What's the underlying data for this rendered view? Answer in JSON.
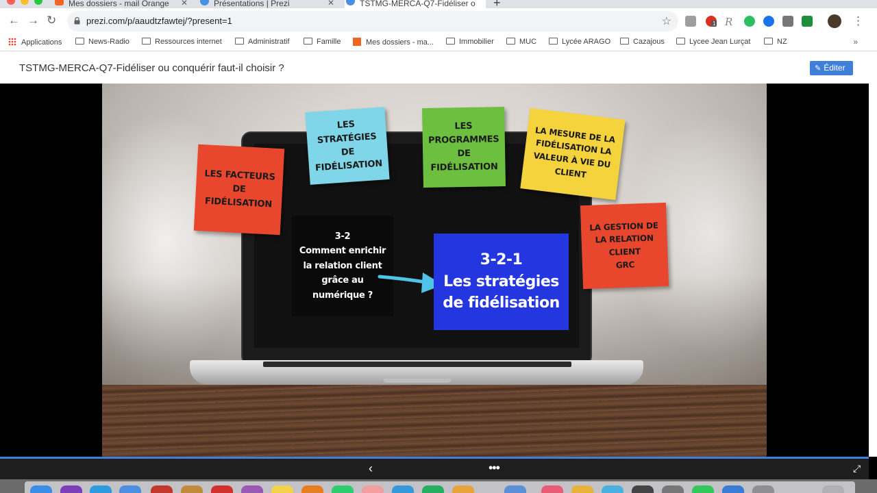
{
  "browser": {
    "tabs": [
      {
        "title": "Mes dossiers - mail Orange",
        "active": false,
        "favicon_color": "#f16522"
      },
      {
        "title": "Présentations | Prezi",
        "active": false,
        "favicon_color": "#4a90e2"
      },
      {
        "title": "TSTMG-MERCA-Q7-Fidéliser o",
        "active": true,
        "favicon_color": "#4a90e2"
      }
    ],
    "url": "prezi.com/p/aaudtzfawtej/?present=1",
    "bookmarks": [
      {
        "label": "Applications",
        "icon": "apps-grid-icon"
      },
      {
        "label": "News-Radio",
        "icon": "folder-icon"
      },
      {
        "label": "Ressources internet",
        "icon": "folder-icon"
      },
      {
        "label": "Administratif",
        "icon": "folder-icon"
      },
      {
        "label": "Famille",
        "icon": "folder-icon"
      },
      {
        "label": "Mes dossiers - ma...",
        "icon": "orange-icon"
      },
      {
        "label": "Immobilier",
        "icon": "folder-icon"
      },
      {
        "label": "MUC",
        "icon": "folder-icon"
      },
      {
        "label": "Lycée ARAGO",
        "icon": "folder-icon"
      },
      {
        "label": "Cazajous",
        "icon": "folder-icon"
      },
      {
        "label": "Lycee Jean Lurçat",
        "icon": "folder-icon"
      },
      {
        "label": "NZ",
        "icon": "folder-icon"
      }
    ],
    "extension_badge": "1"
  },
  "prezi": {
    "title": "TSTMG-MERCA-Q7-Fidéliser ou conquérir faut-il choisir ?",
    "edit_label": "Éditer"
  },
  "slide": {
    "notes": [
      {
        "id": "facteurs",
        "text": "Les facteurs\nde\nfidélisation",
        "color": "#e8472d"
      },
      {
        "id": "strategies",
        "text": "Les stratégies\nde\nfidélisation",
        "color": "#7fd6e8"
      },
      {
        "id": "programmes",
        "text": "Les\nprogrammes\nde\nfidélisation",
        "color": "#6cbf3f"
      },
      {
        "id": "mesure",
        "text": "La mesure de la\nfidélisation la\nvaleur à vie du\nclient",
        "color": "#f5d33c"
      },
      {
        "id": "grc",
        "text": "La gestion de\nla relation\nclient\nGRC",
        "color": "#e8472d"
      }
    ],
    "main_question": "3-2\nComment enrichir\nla relation client\ngrâce au\nnumérique ?",
    "current_topic": "3-2-1\nLes stratégies\nde fidélisation",
    "colors": {
      "black_box": "#0a0a0a",
      "blue_box": "#2436e0",
      "arrow": "#4fc3e8"
    }
  },
  "controls": {
    "prev_icon": "chevron-left-icon",
    "more_icon": "more-dots-icon",
    "fullscreen_icon": "fullscreen-icon",
    "progress_color": "#3f7fd9"
  }
}
